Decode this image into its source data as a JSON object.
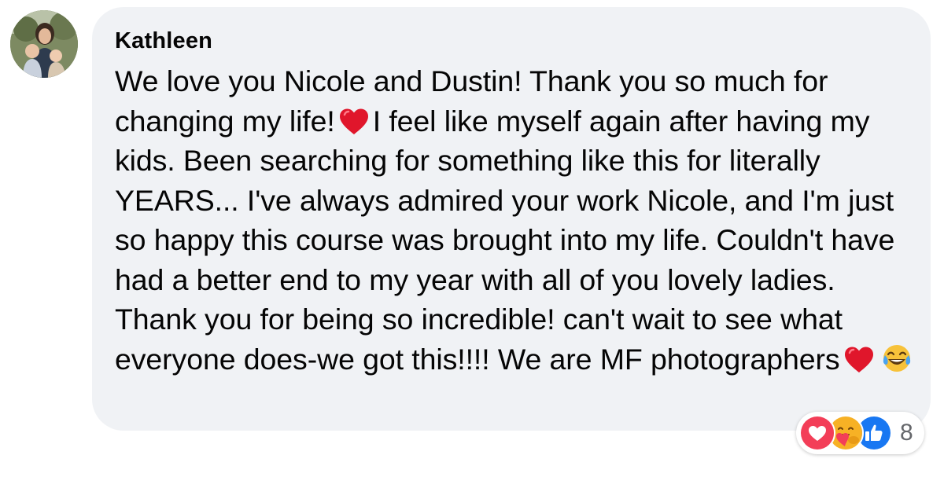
{
  "comment": {
    "author": "Kathleen",
    "text_part1": "We love you Nicole and Dustin! Thank you so much for changing my life!",
    "text_part2": "I feel like myself again after having my kids. Been searching for something like this for literally YEARS... I've always admired your work Nicole, and I'm just so happy this course was brought into my life. Couldn't have had a better end to my year with all of you lovely ladies. Thank you for being so incredible! can't wait to see what everyone does-we got this!!!! We are MF photographers",
    "inline_emojis": [
      "red-heart-icon",
      "red-heart-icon",
      "tears-of-joy-icon"
    ]
  },
  "reactions": {
    "icons": [
      "love-reaction-icon",
      "care-reaction-icon",
      "like-reaction-icon"
    ],
    "count": "8"
  },
  "colors": {
    "bubble_background": "#f0f2f5",
    "text": "#050505",
    "count_text": "#65676b",
    "love": "#f33e58",
    "like": "#1877f2",
    "care": "#f7b125"
  }
}
